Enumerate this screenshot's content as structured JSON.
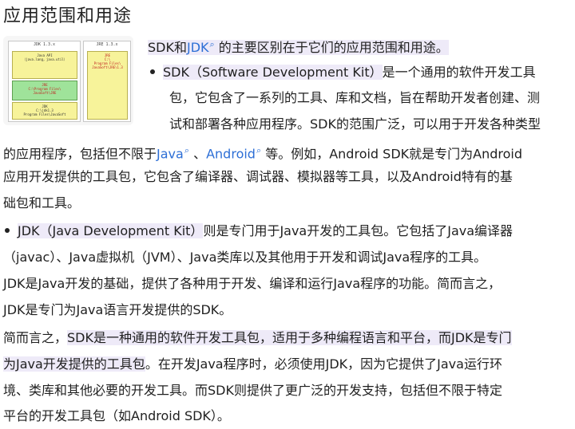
{
  "heading": "应用范围和用途",
  "figure": {
    "jdk_caption": "JDK 1.3.x",
    "jre_caption": "JRE 1.3.x",
    "jdk_box1": "Java API\n（java.lang，java.util）",
    "jdk_box2": "JRE\nC:\\Program Files\\\nJavaSoft\\JRE",
    "jdk_box3": "JDK\nC:\\jdk1.3\nProgram Files\\JavaSoft",
    "jre_box": "JRE\nC:\\\nProgram Files\\\nJavaSoft\\JRE\\1.3"
  },
  "intro": {
    "sdk": "SDK",
    "and": "和",
    "jdk_link": "JDK",
    "rest": "的主要区别在于它们的应用范围和用途。"
  },
  "para1": {
    "lead": "SDK（Software Development Kit）",
    "l1": "是一个通用的软件开发工具",
    "l2": "包，它包含了一系列的工具、库和文档，旨在帮助开发者创建、测",
    "l3": "试和部署各种应用程序。SDK的范围广泛，可以用于开发各种类型",
    "l4a": "的应用程序，包括但不限于",
    "java_link": "Java",
    "sep": "、",
    "android_link": "Android",
    "l4b": "等。例如，Android SDK就是专门为Android",
    "l5": "应用开发提供的工具包，它包含了编译器、调试器、模拟器等工具，以及Android特有的基",
    "l6": "础包和工具。"
  },
  "para2": {
    "lead": "JDK（Java Development Kit）",
    "l1": "则是专门用于Java开发的工具包。它包括了Java编译器",
    "l2": "（javac）、Java虚拟机（JVM）、Java类库以及其他用于开发和调试Java程序的工具。",
    "l3": "JDK是Java开发的基础，提供了各种用于开发、编译和运行Java程序的功能。简而言之，",
    "l4": "JDK是专门为Java语言开发提供的SDK。"
  },
  "summary": {
    "l1a": "简而言之，",
    "l1b": "SDK是一种通用的软件开发工具包，适用于多种编程语言和平台，而JDK是专门",
    "l2a": "为Java开发提供的工具包",
    "l2b": "。在开发Java程序时，必须使用JDK，因为它提供了Java运行环",
    "l3": "境、类库和其他必要的开发工具。而SDK则提供了更广泛的开发支持，包括但不限于特定",
    "l4": "平台的开发工具包（如Android SDK）。"
  }
}
